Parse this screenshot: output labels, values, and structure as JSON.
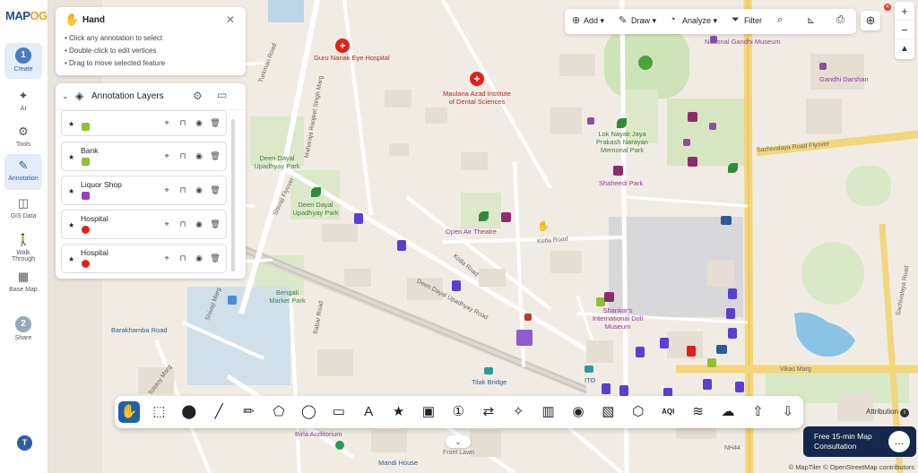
{
  "app": {
    "logo_main": "MAP",
    "logo_accent": "OG"
  },
  "rail": {
    "items": [
      {
        "label": "Create",
        "step": "1",
        "icon": "step-1"
      },
      {
        "label": "AI",
        "icon": "ai-icon",
        "glyph": "✦"
      },
      {
        "label": "Tools",
        "icon": "tools-icon",
        "glyph": "⚙"
      },
      {
        "label": "Annotation",
        "icon": "annotation-icon",
        "glyph": "✎"
      },
      {
        "label": "GIS Data",
        "icon": "database-icon",
        "glyph": "◫"
      },
      {
        "label": "Walk Through",
        "icon": "walk-icon",
        "glyph": "🚶"
      },
      {
        "label": "Base Map",
        "icon": "base-map-icon",
        "glyph": "▦"
      },
      {
        "label": "Share",
        "step": "2",
        "icon": "step-2"
      }
    ],
    "avatar": "T"
  },
  "hand_panel": {
    "title": "Hand",
    "tips": [
      "• Click any annotation to select",
      "• Double-click to edit vertices",
      "• Drag to move selected feature"
    ]
  },
  "layers_panel": {
    "title": "Annotation Layers",
    "layers": [
      {
        "name": "",
        "icon_color": "#8fc031"
      },
      {
        "name": "Bank",
        "icon_color": "#8fc031"
      },
      {
        "name": "Liquor Shop",
        "icon_color": "#9b3fb8"
      },
      {
        "name": "Hospital",
        "icon_color": "#e0201b"
      },
      {
        "name": "Hospital",
        "icon_color": "#e0201b"
      }
    ]
  },
  "top_toolbar": {
    "add": "Add",
    "draw": "Draw",
    "analyze": "Analyze",
    "filter": "Filter"
  },
  "map_labels": [
    {
      "text": "Guru Nanak Eye Hospital",
      "cls": "red"
    },
    {
      "text": "Maulana Azad Institute of Dental Sciences",
      "cls": "red"
    },
    {
      "text": "National Gandhi Museum",
      "cls": "purple"
    },
    {
      "text": "Gandhi Darshan",
      "cls": "purple"
    },
    {
      "text": "Lok Nayak Jaya Prakash Narayan Memorial Park",
      "cls": "green"
    },
    {
      "text": "Shaheedi Park",
      "cls": "purple"
    },
    {
      "text": "Deen Dayal Upadhyay Park",
      "cls": "green"
    },
    {
      "text": "Deen Dayal Upadhyay Park",
      "cls": "green"
    },
    {
      "text": "Open Air Theatre",
      "cls": "purple"
    },
    {
      "text": "Kotla Road",
      "cls": "road"
    },
    {
      "text": "Kotla Road",
      "cls": "road"
    },
    {
      "text": "Deen Dayal Upadhyay Road",
      "cls": "road"
    },
    {
      "text": "Shankar's International Doll Museum",
      "cls": "purple"
    },
    {
      "text": "Bengali Market Park",
      "cls": "green"
    },
    {
      "text": "Barakhamba Road",
      "cls": "blue"
    },
    {
      "text": "Tilak Bridge",
      "cls": "blue"
    },
    {
      "text": "ITO",
      "cls": "blue"
    },
    {
      "text": "Vikas Marg",
      "cls": "road"
    },
    {
      "text": "Sachivalaya Road Flyover",
      "cls": "road"
    },
    {
      "text": "Turkman Road",
      "cls": "road"
    },
    {
      "text": "Maharaja Ranjeet Singh Marg",
      "cls": "road"
    },
    {
      "text": "Shivaji Flyover",
      "cls": "road"
    },
    {
      "text": "Shivaji Marg",
      "cls": "road"
    },
    {
      "text": "Babar Road",
      "cls": "road"
    },
    {
      "text": "Tolstoy Marg",
      "cls": "road"
    },
    {
      "text": "Birla Auditorium",
      "cls": "purple"
    },
    {
      "text": "Mandi House",
      "cls": "blue"
    },
    {
      "text": "Front Lawn",
      "cls": "road"
    },
    {
      "text": "NH44",
      "cls": "road"
    },
    {
      "text": "Sachivalaya Road",
      "cls": "road"
    }
  ],
  "draw_tools": [
    {
      "name": "hand-tool",
      "glyph": "✋"
    },
    {
      "name": "select-tool",
      "glyph": "⬚"
    },
    {
      "name": "marker-tool",
      "glyph": "⬤"
    },
    {
      "name": "line-tool",
      "glyph": "╱"
    },
    {
      "name": "freehand-tool",
      "glyph": "✏"
    },
    {
      "name": "polygon-tool",
      "glyph": "⬠"
    },
    {
      "name": "circle-tool",
      "glyph": "◯"
    },
    {
      "name": "rectangle-tool",
      "glyph": "▭"
    },
    {
      "name": "text-tool",
      "glyph": "A"
    },
    {
      "name": "star-tool",
      "glyph": "★"
    },
    {
      "name": "image-tool",
      "glyph": "▣"
    },
    {
      "name": "number-tool",
      "glyph": "①"
    },
    {
      "name": "route-tool",
      "glyph": "⇄"
    },
    {
      "name": "shape-tool",
      "glyph": "✧"
    },
    {
      "name": "building-tool",
      "glyph": "▥"
    },
    {
      "name": "camera-tool",
      "glyph": "◉"
    },
    {
      "name": "photo-tool",
      "glyph": "▧"
    },
    {
      "name": "3d-tool",
      "glyph": "⬡"
    },
    {
      "name": "aqi-tool",
      "glyph": "AQI"
    },
    {
      "name": "wind-tool",
      "glyph": "≋"
    },
    {
      "name": "weather-tool",
      "glyph": "☁"
    },
    {
      "name": "upload-tool",
      "glyph": "⇧"
    },
    {
      "name": "download-tool",
      "glyph": "⇩"
    }
  ],
  "attribution": "Attribution",
  "consult": {
    "line1": "Free 15-min Map",
    "line2": "Consultation"
  },
  "copyright": "© MapTiler © OpenStreetMap contributors"
}
